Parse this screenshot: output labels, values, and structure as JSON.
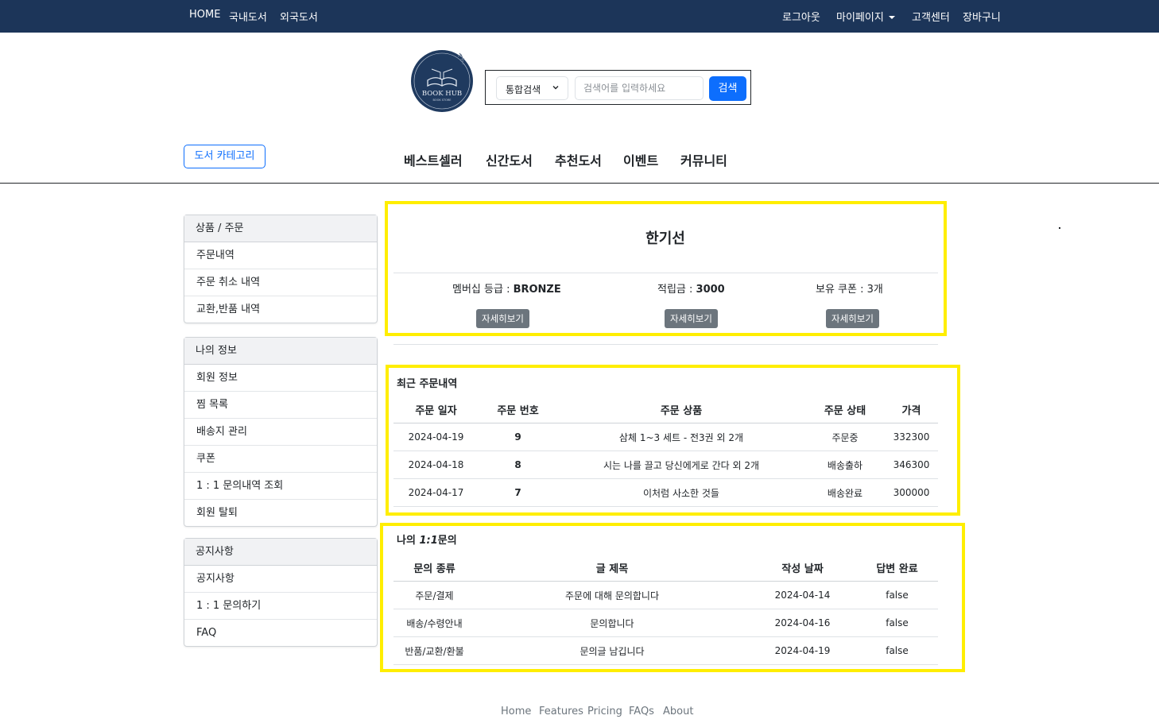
{
  "topnav": {
    "left": [
      "HOME",
      "국내도서",
      "외국도서"
    ],
    "logout": "로그아웃",
    "mypage": "마이페이지",
    "support": "고객센터",
    "cart": "장바구니"
  },
  "logo": {
    "main": "BOOK HUB",
    "sub": "BOOK STORE"
  },
  "search": {
    "select": "통합검색",
    "placeholder": "검색어를 입력하세요",
    "button": "검색"
  },
  "category_button": "도서 카테고리",
  "mainnav": [
    "베스트셀러",
    "신간도서",
    "추천도서",
    "이벤트",
    "커뮤니티"
  ],
  "sidebar": [
    {
      "title": "상품 / 주문",
      "items": [
        "주문내역",
        "주문 취소 내역",
        "교환,반품 내역"
      ]
    },
    {
      "title": "나의 정보",
      "items": [
        "회원 정보",
        "찜 목록",
        "배송지 관리",
        "쿠폰",
        "1 : 1 문의내역 조회",
        "회원 탈퇴"
      ]
    },
    {
      "title": "공지사항",
      "items": [
        "공지사항",
        "1 : 1 문의하기",
        "FAQ"
      ]
    }
  ],
  "profile": {
    "name": "한기선",
    "membership_label": "멤버십 등급 : ",
    "membership": "BRONZE",
    "points_label": "적립금 : ",
    "points": "3000",
    "coupons_label": "보유 쿠폰 : ",
    "coupons": "3개",
    "detail_button": "자세히보기"
  },
  "orders": {
    "title": "최근 주문내역",
    "headers": [
      "주문 일자",
      "주문 번호",
      "주문 상품",
      "주문 상태",
      "가격"
    ],
    "rows": [
      [
        "2024-04-19",
        "9",
        "삼체 1~3 세트 - 전3권 외 2개",
        "주문중",
        "332300"
      ],
      [
        "2024-04-18",
        "8",
        "시는 나를 끌고 당신에게로 간다 외 2개",
        "배송출하",
        "346300"
      ],
      [
        "2024-04-17",
        "7",
        "이처럼 사소한 것들",
        "배송완료",
        "300000"
      ]
    ]
  },
  "inquiries": {
    "title_prefix": "나의 ",
    "title_mid": "1:1",
    "title_suffix": "문의",
    "headers": [
      "문의 종류",
      "글 제목",
      "작성 날짜",
      "답변 완료"
    ],
    "rows": [
      [
        "주문/결제",
        "주문에 대해 문의합니다",
        "2024-04-14",
        "false"
      ],
      [
        "배송/수령안내",
        "문의합니다",
        "2024-04-16",
        "false"
      ],
      [
        "반품/교환/환불",
        "문의글 남깁니다",
        "2024-04-19",
        "false"
      ]
    ]
  },
  "footer": [
    "Home",
    "Features",
    "Pricing",
    "FAQs",
    "About"
  ],
  "colors": {
    "navbar": "#1c3559",
    "primary": "#0d6efd",
    "highlight": "#ffee00",
    "secondary_button": "#6c757d"
  }
}
